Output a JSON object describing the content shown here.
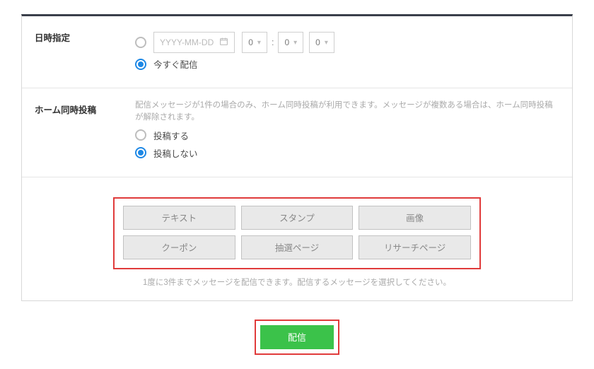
{
  "datetime": {
    "label": "日時指定",
    "date_placeholder": "YYYY-MM-DD",
    "hour": "0",
    "minute1": "0",
    "minute2": "0",
    "immediate_label": "今すぐ配信",
    "selected": "immediate"
  },
  "home_post": {
    "label": "ホーム同時投稿",
    "hint": "配信メッセージが1件の場合のみ、ホーム同時投稿が利用できます。メッセージが複数ある場合は、ホーム同時投稿が解除されます。",
    "option_yes": "投稿する",
    "option_no": "投稿しない",
    "selected": "no"
  },
  "message_types": {
    "items": [
      "テキスト",
      "スタンプ",
      "画像",
      "クーポン",
      "抽選ページ",
      "リサーチページ"
    ],
    "note": "1度に3件までメッセージを配信できます。配信するメッセージを選択してください。"
  },
  "send_button": "配信",
  "colors": {
    "highlight_border": "#e03b3b",
    "primary_green": "#3bc24a",
    "radio_selected": "#1e88e5"
  }
}
